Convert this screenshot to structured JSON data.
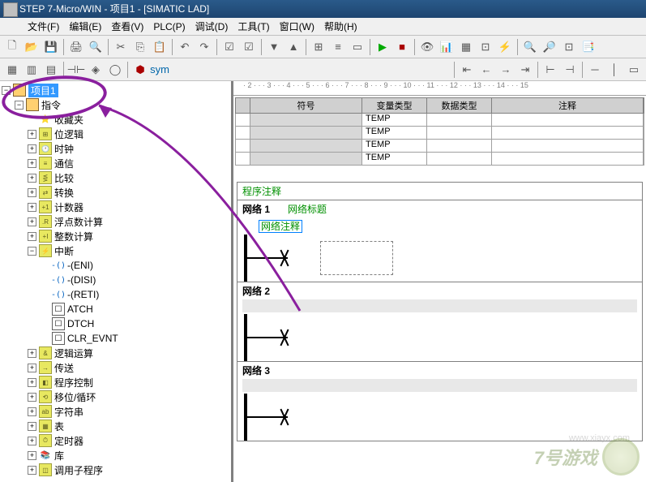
{
  "title": "STEP 7-Micro/WIN - 项目1 - [SIMATIC LAD]",
  "menu": [
    "文件(F)",
    "编辑(E)",
    "查看(V)",
    "PLC(P)",
    "调试(D)",
    "工具(T)",
    "窗口(W)",
    "帮助(H)"
  ],
  "ruler_text": "· 2 · · · 3 · · · 4 · · · 5 · · · 6 · · · 7 · · · 8 · · · 9 · · · 10 · · · 11 · · · 12 · · · 13 · · · 14 · · · 15",
  "tree": {
    "root": "项目1",
    "cmds": "指令",
    "items": [
      "收藏夹",
      "位逻辑",
      "时钟",
      "通信",
      "比较",
      "转换",
      "计数器",
      "浮点数计算",
      "整数计算",
      "中断"
    ],
    "interrupts": [
      "-(ENI)",
      "-(DISI)",
      "-(RETI)",
      "ATCH",
      "DTCH",
      "CLR_EVNT"
    ],
    "items2": [
      "逻辑运算",
      "传送",
      "程序控制",
      "移位/循环",
      "字符串",
      "表",
      "定时器",
      "库",
      "调用子程序"
    ]
  },
  "varheader": {
    "c1": "",
    "c2": "符号",
    "c3": "变量类型",
    "c4": "数据类型",
    "c5": "注释"
  },
  "vartype": "TEMP",
  "prog": {
    "comment": "程序注释",
    "net1": "网络 1",
    "net1title": "网络标题",
    "net1c": "网络注释",
    "net2": "网络 2",
    "net3": "网络 3"
  },
  "watermark": {
    "text": "7号游戏",
    "url": "www.xiayx.com"
  }
}
